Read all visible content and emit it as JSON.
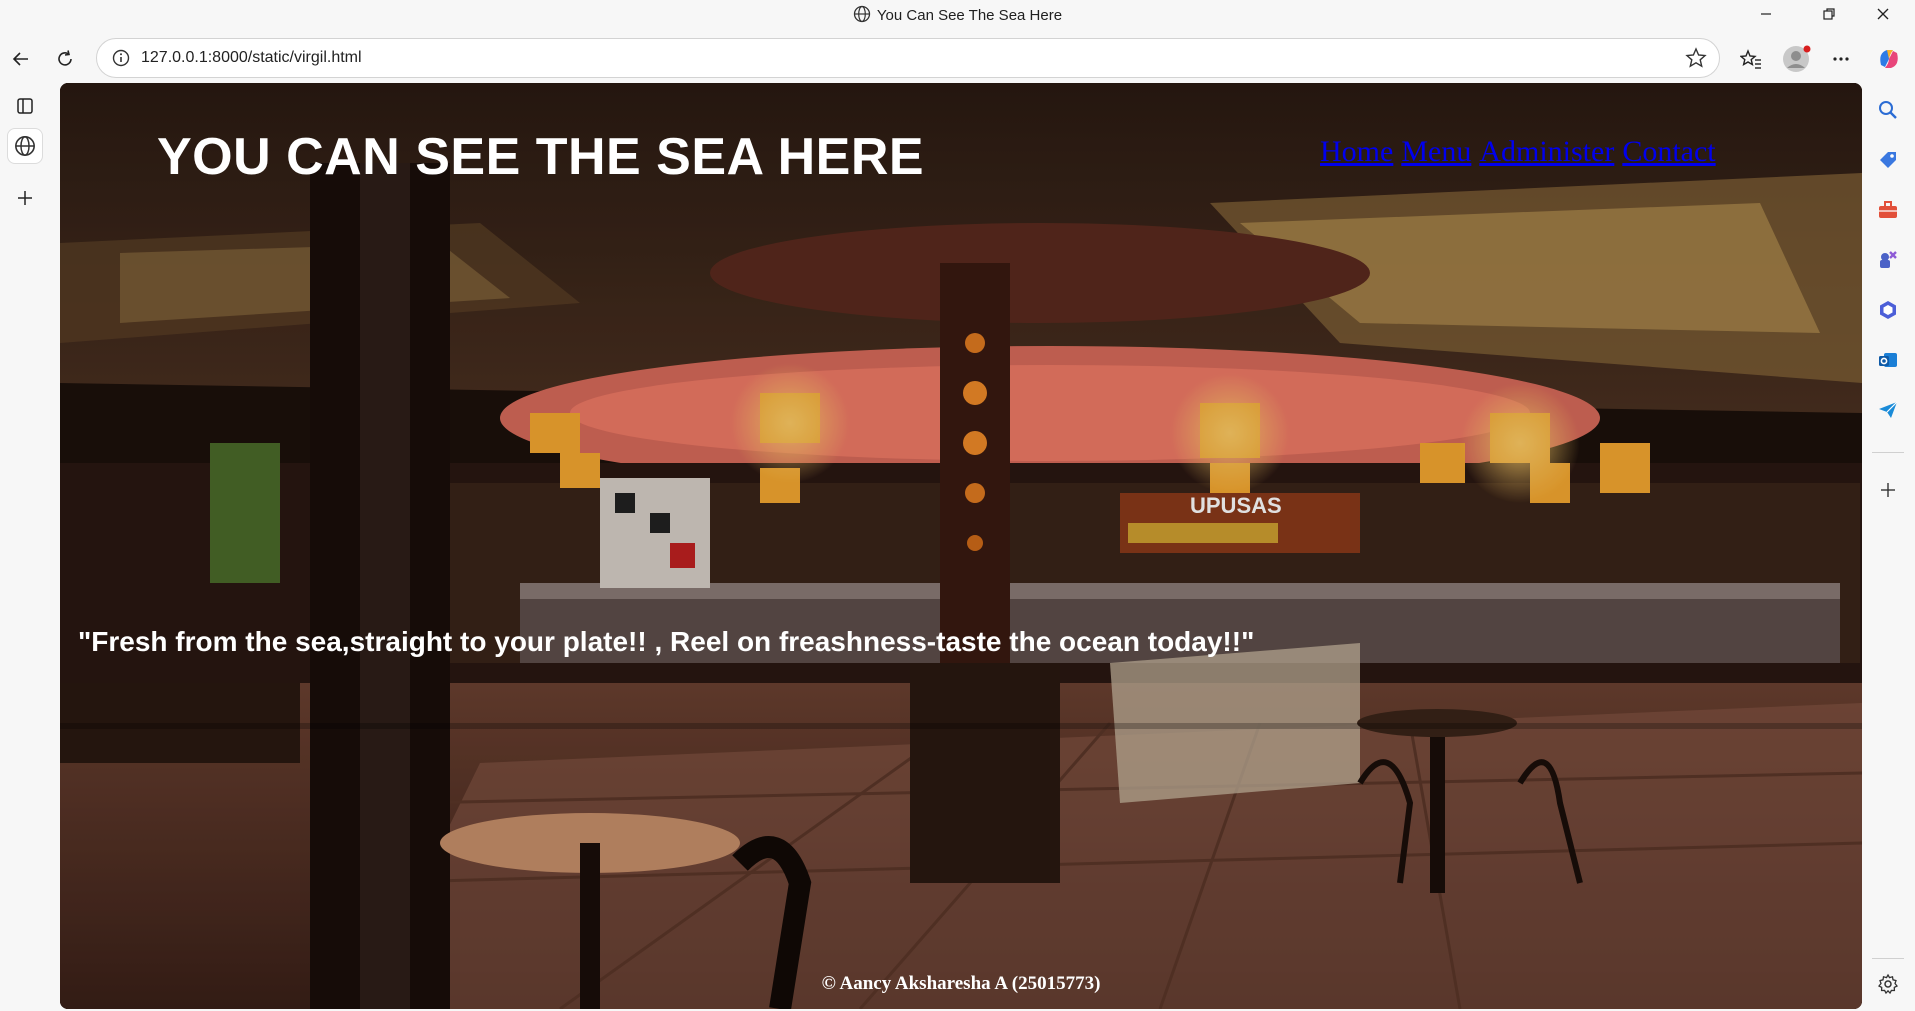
{
  "window": {
    "title": "You Can See The Sea Here"
  },
  "browser": {
    "url": "127.0.0.1:8000/static/virgil.html"
  },
  "page": {
    "site_title": "YOU CAN SEE THE SEA HERE",
    "nav": [
      "Home",
      "Menu",
      "Administer",
      "Contact"
    ],
    "tagline": "\"Fresh from the sea,straight to your plate!! , Reel on freashness-taste the ocean today!!\"",
    "footer": "© Aancy Aksharesha A (25015773)"
  },
  "colors": {
    "link": "#0000ee",
    "text_on_image": "#ffffff"
  }
}
